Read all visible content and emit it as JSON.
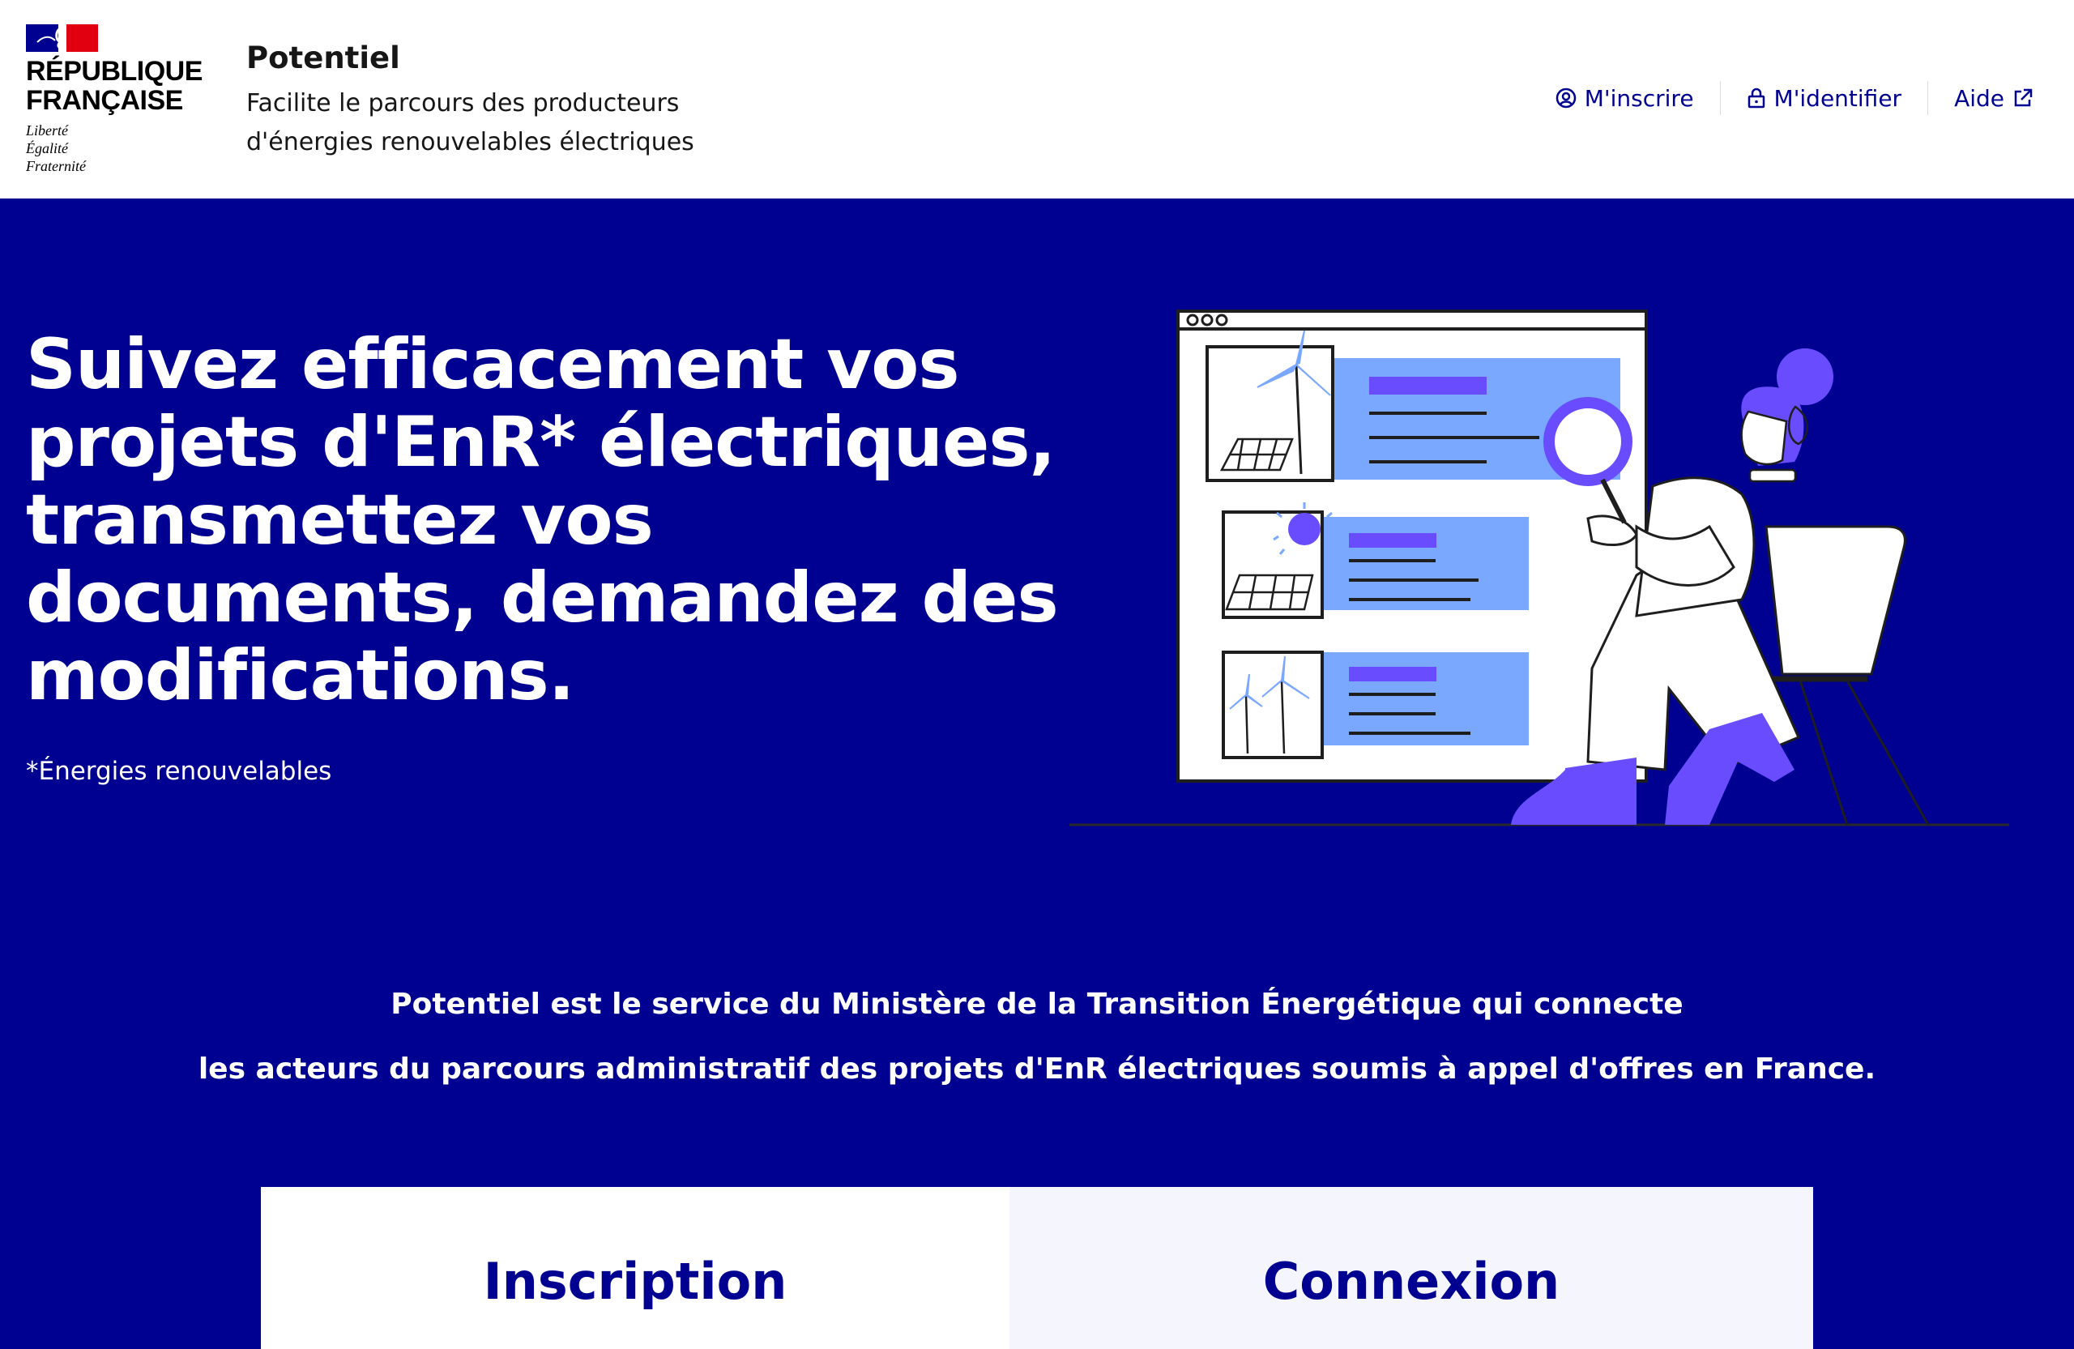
{
  "header": {
    "logo": {
      "name": "RÉPUBLIQUE FRANÇAISE",
      "motto": [
        "Liberté",
        "Égalité",
        "Fraternité"
      ]
    },
    "service_title": "Potentiel",
    "tagline": "Facilite le parcours des producteurs d'énergies renouvelables électriques",
    "tools": {
      "register_label": "M'inscrire",
      "login_label": "M'identifier",
      "help_label": "Aide"
    }
  },
  "hero": {
    "title": "Suivez efficacement vos projets d'EnR* électriques, transmettez vos documents, demandez des modifications.",
    "footnote": "*Énergies renouvelables"
  },
  "intro": {
    "line1": "Potentiel est le service du Ministère de la Transition Énergétique qui connecte",
    "line2": "les acteurs du parcours administratif des projets d'EnR électriques soumis à appel d'offres en France."
  },
  "cards": {
    "signup_title": "Inscription",
    "login_title": "Connexion"
  },
  "colors": {
    "brand_blue": "#000091",
    "accent_purple": "#6a4cff",
    "panel_light_blue": "#7aa7ff",
    "marianne_red": "#e1000f"
  }
}
